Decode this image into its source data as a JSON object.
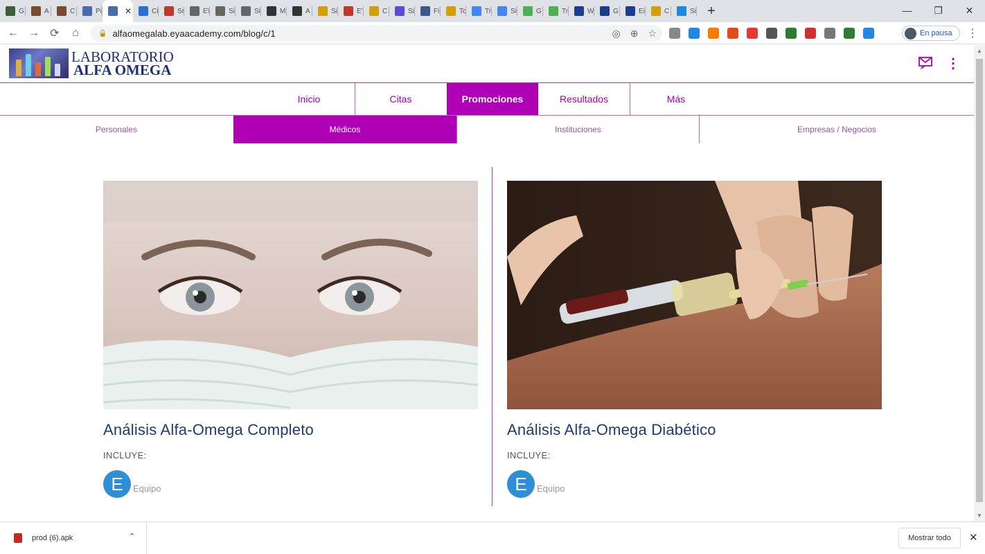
{
  "browser": {
    "tabs": [
      {
        "label": "G",
        "color": "#3b5f3b"
      },
      {
        "label": "A",
        "color": "#7a4a2a"
      },
      {
        "label": "C",
        "color": "#7a4a2a"
      },
      {
        "label": "Pi",
        "color": "#4b6bb0"
      },
      {
        "label": "",
        "color": "#4b6bb0",
        "active": true
      },
      {
        "label": "Ci",
        "color": "#2a6fd6"
      },
      {
        "label": "Sr",
        "color": "#c0392b"
      },
      {
        "label": "E\\",
        "color": "#666666"
      },
      {
        "label": "Si",
        "color": "#666666"
      },
      {
        "label": "Si",
        "color": "#666666"
      },
      {
        "label": "M",
        "color": "#333333"
      },
      {
        "label": "A",
        "color": "#333333"
      },
      {
        "label": "Si",
        "color": "#d4a000"
      },
      {
        "label": "E'",
        "color": "#c0392b"
      },
      {
        "label": "C",
        "color": "#d4a000"
      },
      {
        "label": "Si",
        "color": "#5b4bd6"
      },
      {
        "label": "Fi",
        "color": "#3a5a8c"
      },
      {
        "label": "Tc",
        "color": "#d4a000"
      },
      {
        "label": "Tr",
        "color": "#4285f4"
      },
      {
        "label": "Si",
        "color": "#4285f4"
      },
      {
        "label": "G",
        "color": "#4caf50"
      },
      {
        "label": "Tr",
        "color": "#4caf50"
      },
      {
        "label": "W",
        "color": "#1a3d8f"
      },
      {
        "label": "G",
        "color": "#1a3d8f"
      },
      {
        "label": "Ei",
        "color": "#1a3d8f"
      },
      {
        "label": "C",
        "color": "#d4a000"
      },
      {
        "label": "Si",
        "color": "#1e88e5"
      }
    ],
    "active_tab_close": "✕",
    "new_tab": "+",
    "window_controls": [
      "—",
      "❐",
      "✕"
    ],
    "url": "alfaomegalab.eyaacademy.com/blog/c/1",
    "profile_label": "En pausa",
    "extension_colors": [
      "#888888",
      "#1e88e5",
      "#f57c00",
      "#e64a19",
      "#e53935",
      "#555555",
      "#2e7d32",
      "#d32f2f",
      "#777777",
      "#2e7d32",
      "#1e88e5"
    ]
  },
  "site": {
    "logo_line1": "LABORATORIO",
    "logo_line2": "ALFA OMEGA",
    "accent_color": "#b000b5"
  },
  "mainnav": {
    "items": [
      {
        "label": "Inicio"
      },
      {
        "label": "Citas"
      },
      {
        "label": "Promociones",
        "active": true
      },
      {
        "label": "Resultados"
      },
      {
        "label": "Más"
      }
    ]
  },
  "subnav": {
    "items": [
      {
        "label": "Personales"
      },
      {
        "label": "Médicos",
        "active": true
      },
      {
        "label": "Instituciones"
      },
      {
        "label": "Empresas / Negocios"
      }
    ]
  },
  "cards": [
    {
      "title": "Análisis Alfa-Omega Completo",
      "includes_label": "INCLUYE:",
      "badge_letter": "E",
      "item_label": "Equipo"
    },
    {
      "title": "Análisis Alfa-Omega Diabético",
      "includes_label": "INCLUYE:",
      "badge_letter": "E",
      "item_label": "Equipo"
    }
  ],
  "downloads": {
    "filename": "prod (6).apk",
    "show_all": "Mostrar todo"
  }
}
